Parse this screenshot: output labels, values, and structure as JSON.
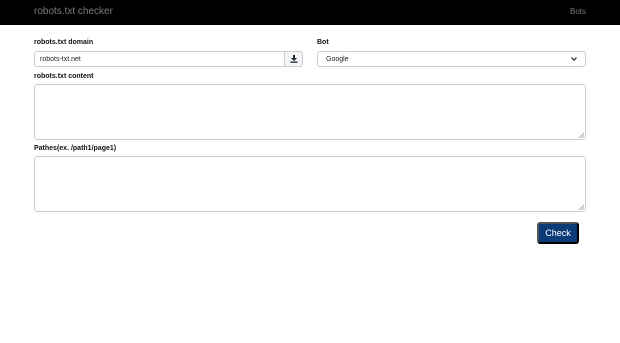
{
  "navbar": {
    "brand": "robots.txt checker",
    "link": "Bots"
  },
  "form": {
    "domain_label": "robots.txt domain",
    "domain_value": "robots-txt.net",
    "bot_label": "Bot",
    "bot_selected": "Google",
    "content_label": "robots.txt content",
    "content_value": "",
    "paths_label": "Pathes(ex. /path1/page1)",
    "paths_value": "",
    "check_button": "Check"
  },
  "icons": {
    "download": "download-icon",
    "dropdown": "chevron-down-icon"
  },
  "colors": {
    "navbar_bg": "#000000",
    "navbar_text": "#7c7c7c",
    "button_bg": "#0b3c78",
    "border": "#c9ced4"
  }
}
